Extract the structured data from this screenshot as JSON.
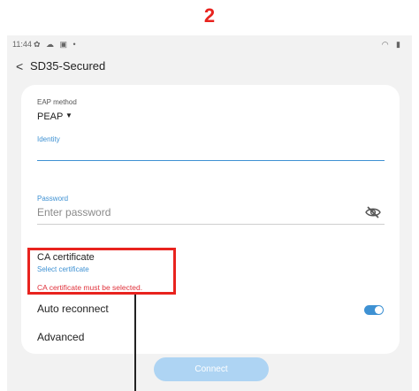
{
  "annotation": {
    "step_number": "2",
    "highlight_color": "#e8231e"
  },
  "status_bar": {
    "time": "11:44",
    "left_icons": "✿ ☁ ▣ •",
    "right_icons": "◠ ▮"
  },
  "header": {
    "back_icon": "chevron-left-icon",
    "title": "SD35-Secured"
  },
  "form": {
    "eap_method": {
      "label": "EAP method",
      "value": "PEAP"
    },
    "identity": {
      "label": "Identity",
      "value": ""
    },
    "password": {
      "label": "Password",
      "placeholder": "Enter password",
      "toggle_icon": "eye-off-icon"
    },
    "ca_certificate": {
      "title": "CA certificate",
      "value": "Select certificate",
      "error": "CA certificate must be selected."
    },
    "auto_reconnect": {
      "label": "Auto reconnect",
      "enabled": true
    },
    "advanced": {
      "label": "Advanced"
    }
  },
  "connect_button": {
    "label": "Connect",
    "enabled": false
  },
  "colors": {
    "accent": "#3e91d3",
    "error": "#e0313b",
    "background": "#f2f2f2",
    "button_disabled": "#aed4f3"
  }
}
